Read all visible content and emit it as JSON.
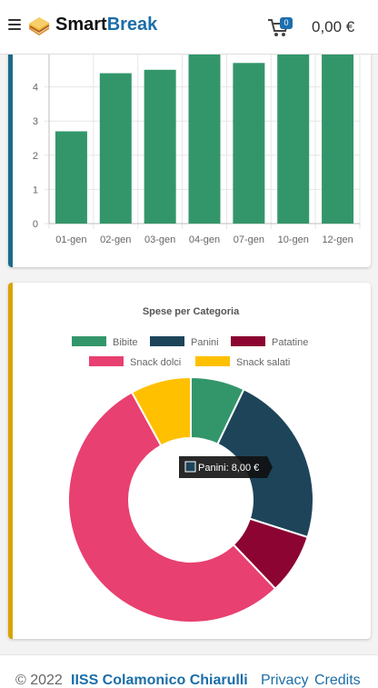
{
  "header": {
    "brand_part1": "Smart",
    "brand_part2": "Break",
    "cart_count": "0",
    "cart_total": "0,00 €"
  },
  "footer": {
    "copyright": "© 2022",
    "org": "IISS Colamonico Chiarulli",
    "privacy": "Privacy",
    "credits": "Credits"
  },
  "colors": {
    "brand": "#1b6ea8",
    "accent_card1": "#1a6b8a",
    "accent_card2": "#d9a400"
  },
  "chart_data": [
    {
      "type": "bar",
      "title": "",
      "categories": [
        "01-gen",
        "02-gen",
        "03-gen",
        "04-gen",
        "07-gen",
        "10-gen",
        "12-gen"
      ],
      "values": [
        2.7,
        4.4,
        4.5,
        5.0,
        4.7,
        5.0,
        5.0
      ],
      "yticks": [
        "0",
        "1",
        "2",
        "3",
        "4"
      ],
      "ylim": [
        0,
        5
      ],
      "color": "#33966b",
      "grid": true
    },
    {
      "type": "pie",
      "title": "Spese per Categoria",
      "labels": [
        "Bibite",
        "Panini",
        "Patatine",
        "Snack dolci",
        "Snack salati"
      ],
      "values": [
        2.5,
        8.0,
        2.8,
        19.0,
        2.8
      ],
      "colors": [
        "#33966b",
        "#1d4459",
        "#8b0432",
        "#e84070",
        "#ffc000"
      ],
      "legend_position": "top",
      "tooltip": "Panini: 8,00 €"
    }
  ]
}
